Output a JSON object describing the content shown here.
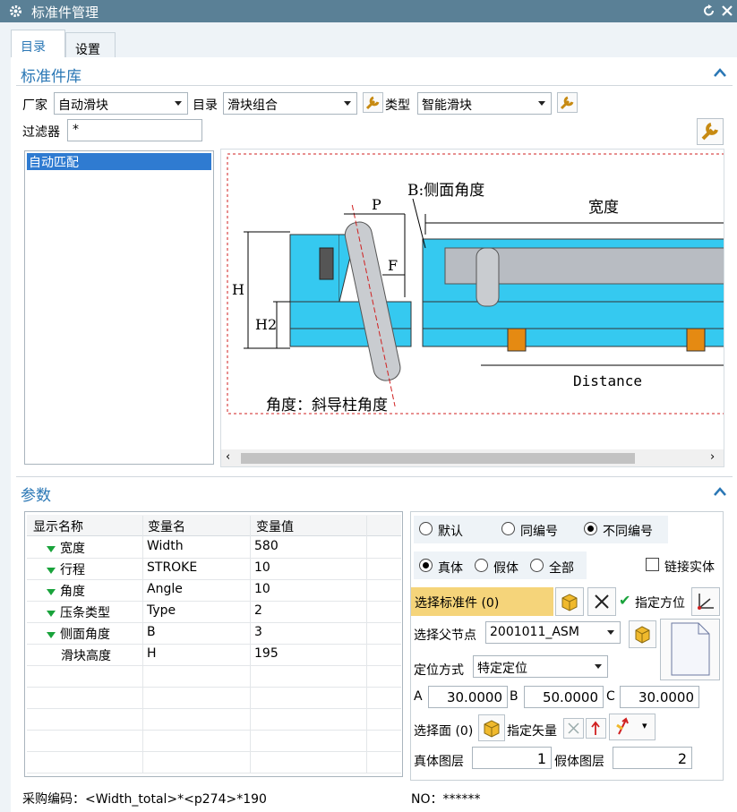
{
  "window": {
    "title": "标准件管理"
  },
  "tabs": [
    {
      "label": "目录"
    },
    {
      "label": "设置"
    }
  ],
  "library": {
    "section_title": "标准件库",
    "vendor_label": "厂家",
    "vendor_value": "自动滑块",
    "catalog_label": "目录",
    "catalog_value": "滑块组合",
    "type_label": "类型",
    "type_value": "智能滑块",
    "filter_label": "过滤器",
    "filter_value": "*",
    "tree_items": [
      "自动匹配"
    ]
  },
  "diagram": {
    "labels": {
      "b": "B:侧面角度",
      "width": "宽度",
      "p": "P",
      "f": "F",
      "h": "H",
      "h2": "H2",
      "distance": "Distance",
      "angle": "角度：斜导柱角度"
    }
  },
  "params": {
    "section_title": "参数",
    "columns": [
      "显示名称",
      "变量名",
      "变量值"
    ],
    "rows": [
      {
        "name": "宽度",
        "var": "Width",
        "value": "580",
        "expandable": true
      },
      {
        "name": "行程",
        "var": "STROKE",
        "value": "10",
        "expandable": true
      },
      {
        "name": "角度",
        "var": "Angle",
        "value": "10",
        "expandable": true
      },
      {
        "name": "压条类型",
        "var": "Type",
        "value": "2",
        "expandable": true
      },
      {
        "name": "侧面角度",
        "var": "B",
        "value": "3",
        "expandable": true
      },
      {
        "name": "滑块高度",
        "var": "H",
        "value": "195",
        "expandable": false
      }
    ],
    "purchase_code": "采购编码：<Width_total>*<p274>*190",
    "no_text": "NO：******"
  },
  "options": {
    "numbering": [
      {
        "label": "默认",
        "selected": false
      },
      {
        "label": "同编号",
        "selected": false
      },
      {
        "label": "不同编号",
        "selected": true
      }
    ],
    "body": [
      {
        "label": "真体",
        "selected": true
      },
      {
        "label": "假体",
        "selected": false
      },
      {
        "label": "全部",
        "selected": false
      }
    ],
    "link_solid_label": "链接实体",
    "select_part_label": "选择标准件 (0)",
    "specify_orientation_label": "指定方位",
    "select_parent_label": "选择父节点",
    "parent_value": "2001011_ASM",
    "position_label": "定位方式",
    "position_value": "特定定位",
    "a_label": "A",
    "a_value": "30.0000",
    "b_label": "B",
    "b_value": "50.0000",
    "c_label": "C",
    "c_value": "30.0000",
    "select_face_label": "选择面 (0)",
    "specify_vector_label": "指定矢量",
    "real_layer_label": "真体图层",
    "real_layer_value": "1",
    "fake_layer_label": "假体图层",
    "fake_layer_value": "2"
  },
  "colors": {
    "accent": "#2a77b5",
    "titlebar": "#5a8096",
    "highlight": "#f5d47a",
    "check": "#19a33b"
  }
}
